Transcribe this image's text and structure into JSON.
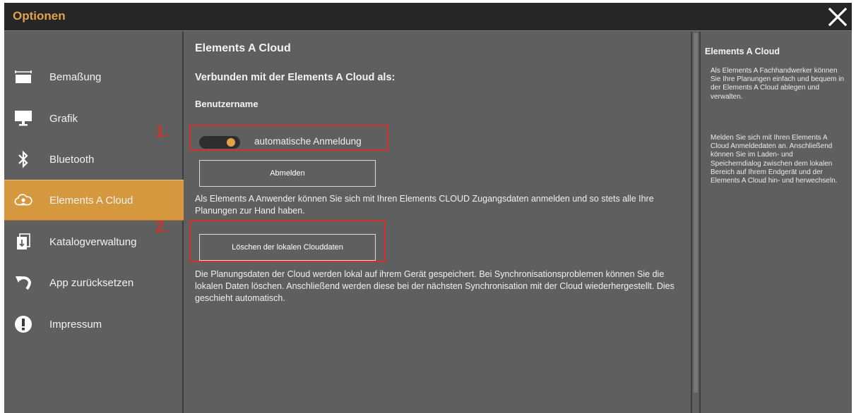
{
  "window": {
    "title": "Optionen"
  },
  "sidebar": {
    "items": [
      {
        "label": "Bemaßung",
        "icon": "dimension-icon"
      },
      {
        "label": "Grafik",
        "icon": "monitor-icon"
      },
      {
        "label": "Bluetooth",
        "icon": "bluetooth-icon"
      },
      {
        "label": "Elements A Cloud",
        "icon": "cloud-icon",
        "active": true
      },
      {
        "label": "Katalogverwaltung",
        "icon": "catalog-icon"
      },
      {
        "label": "App zurücksetzen",
        "icon": "reset-icon"
      },
      {
        "label": "Impressum",
        "icon": "info-icon"
      }
    ]
  },
  "main": {
    "title": "Elements A Cloud",
    "connected_label": "Verbunden mit der Elements A Cloud als:",
    "username": "Benutzername",
    "auto_login_label": "automatische Anmeldung",
    "auto_login_enabled": true,
    "logout_button": "Abmelden",
    "login_info": "Als Elements A Anwender können Sie sich mit Ihren Elements CLOUD Zugangsdaten anmelden und so stets alle Ihre Planungen zur Hand haben.",
    "delete_button": "Löschen der lokalen Clouddaten",
    "delete_info": "Die Planungsdaten der Cloud werden lokal auf ihrem Gerät gespeichert. Bei Synchronisationsproblemen können Sie die lokalen Daten löschen. Anschließend werden diese bei der nächsten Synchronisation mit der Cloud wiederhergestellt. Dies geschieht automatisch."
  },
  "annotations": {
    "marker1": "1.",
    "marker2": "2."
  },
  "help": {
    "title": "Elements A Cloud",
    "paragraph1": "Als Elements A Fachhandwerker können Sie Ihre Planungen einfach und bequem in der Elements A Cloud ablegen und verwalten.",
    "paragraph2": "Melden Sie sich mit Ihren Elements A Cloud Anmeldedaten an. Anschließend können Sie im Laden- und Speicherndialog zwischen dem lokalen Bereich auf Ihrem Endgerät und der Elements A Cloud hin- und herwechseln."
  },
  "colors": {
    "accent": "#d6983f",
    "title_orange": "#e2a14a",
    "background": "#5f5f5f",
    "annotation_red": "#d0312d"
  }
}
